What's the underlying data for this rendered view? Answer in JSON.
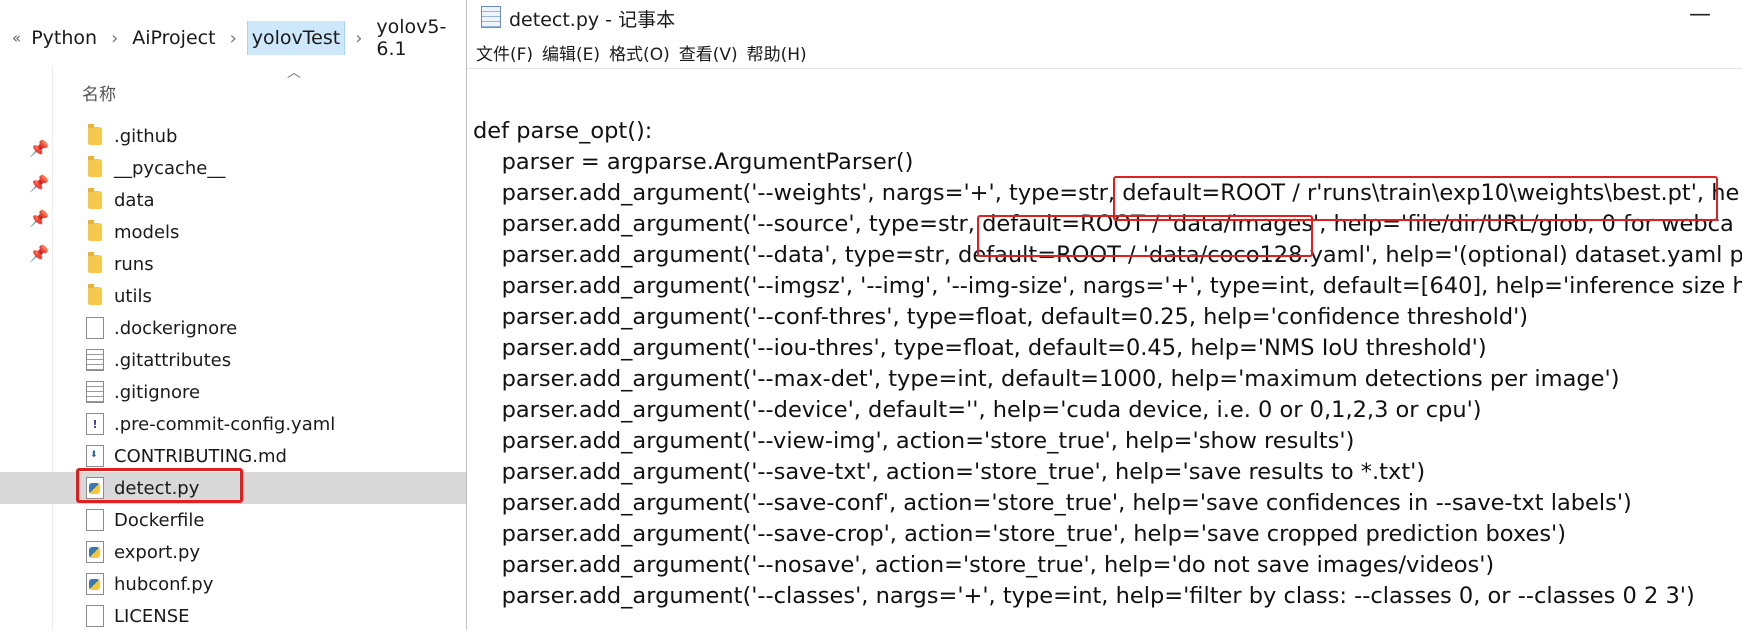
{
  "explorer": {
    "breadcrumb": {
      "overflow": "«",
      "items": [
        "Python",
        "AiProject",
        "yolovTest",
        "yolov5-6.1"
      ]
    },
    "column_header": "名称",
    "files": [
      {
        "name": ".github",
        "type": "folder"
      },
      {
        "name": "__pycache__",
        "type": "folder"
      },
      {
        "name": "data",
        "type": "folder"
      },
      {
        "name": "models",
        "type": "folder"
      },
      {
        "name": "runs",
        "type": "folder"
      },
      {
        "name": "utils",
        "type": "folder"
      },
      {
        "name": ".dockerignore",
        "type": "file"
      },
      {
        "name": ".gitattributes",
        "type": "text-file"
      },
      {
        "name": ".gitignore",
        "type": "text-file"
      },
      {
        "name": ".pre-commit-config.yaml",
        "type": "yaml-file"
      },
      {
        "name": "CONTRIBUTING.md",
        "type": "md-file"
      },
      {
        "name": "detect.py",
        "type": "python-file",
        "selected": true
      },
      {
        "name": "Dockerfile",
        "type": "file"
      },
      {
        "name": "export.py",
        "type": "python-file"
      },
      {
        "name": "hubconf.py",
        "type": "python-file"
      },
      {
        "name": "LICENSE",
        "type": "file"
      }
    ]
  },
  "notepad": {
    "title": "detect.py - 记事本",
    "minimize": "—",
    "menu": [
      "文件(F)",
      "编辑(E)",
      "格式(O)",
      "查看(V)",
      "帮助(H)"
    ],
    "code": [
      "def parse_opt():",
      "    parser = argparse.ArgumentParser()",
      "    parser.add_argument('--weights', nargs='+', type=str, default=ROOT / r'runs\\train\\exp10\\weights\\best.pt', he",
      "    parser.add_argument('--source', type=str, default=ROOT / 'data/images', help='file/dir/URL/glob, 0 for webca",
      "    parser.add_argument('--data', type=str, default=ROOT / 'data/coco128.yaml', help='(optional) dataset.yaml p",
      "    parser.add_argument('--imgsz', '--img', '--img-size', nargs='+', type=int, default=[640], help='inference size h",
      "    parser.add_argument('--conf-thres', type=float, default=0.25, help='confidence threshold')",
      "    parser.add_argument('--iou-thres', type=float, default=0.45, help='NMS IoU threshold')",
      "    parser.add_argument('--max-det', type=int, default=1000, help='maximum detections per image')",
      "    parser.add_argument('--device', default='', help='cuda device, i.e. 0 or 0,1,2,3 or cpu')",
      "    parser.add_argument('--view-img', action='store_true', help='show results')",
      "    parser.add_argument('--save-txt', action='store_true', help='save results to *.txt')",
      "    parser.add_argument('--save-conf', action='store_true', help='save confidences in --save-txt labels')",
      "    parser.add_argument('--save-crop', action='store_true', help='save cropped prediction boxes')",
      "    parser.add_argument('--nosave', action='store_true', help='do not save images/videos')",
      "    parser.add_argument('--classes', nargs='+', type=int, help='filter by class: --classes 0, or --classes 0 2 3')"
    ]
  }
}
